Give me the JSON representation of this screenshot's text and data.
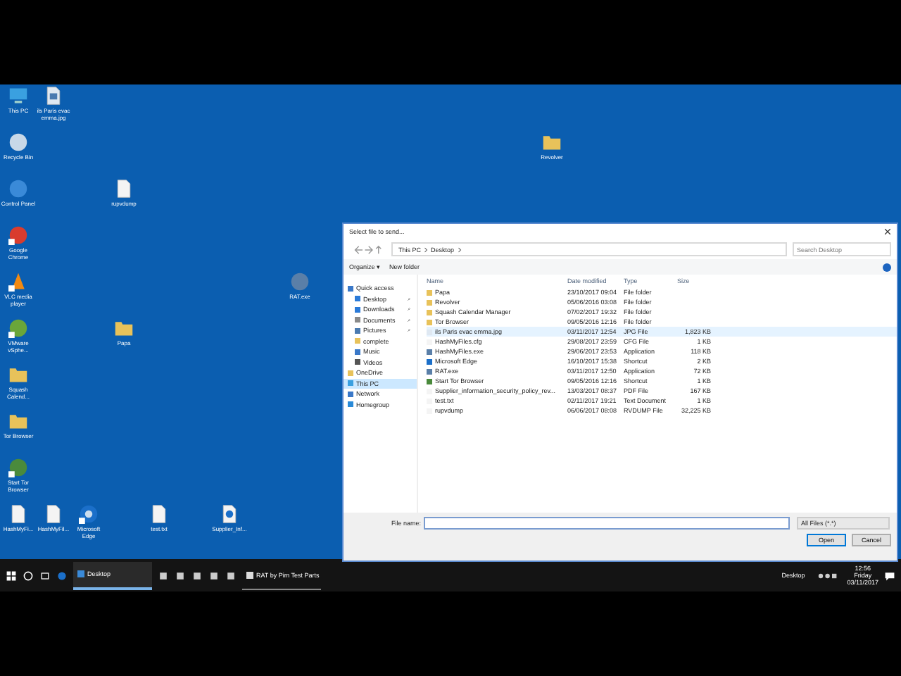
{
  "desktop_icons": [
    {
      "label": "This PC",
      "kind": "pc",
      "shortcut": false
    },
    {
      "label": "ils Paris evac emma.jpg",
      "kind": "image",
      "shortcut": false
    },
    {
      "label": "Recycle Bin",
      "kind": "recycle",
      "shortcut": false
    },
    {
      "label": "Control Panel",
      "kind": "control",
      "shortcut": false
    },
    {
      "label": "rupvdump",
      "kind": "file",
      "shortcut": false
    },
    {
      "label": "Google Chrome",
      "kind": "chrome",
      "shortcut": true
    },
    {
      "label": "VLC media player",
      "kind": "vlc",
      "shortcut": true
    },
    {
      "label": "VMware vSphe...",
      "kind": "vmware",
      "shortcut": true
    },
    {
      "label": "Papa",
      "kind": "folder",
      "shortcut": false
    },
    {
      "label": "Squash Calend...",
      "kind": "folder",
      "shortcut": false
    },
    {
      "label": "Tor Browser",
      "kind": "folder",
      "shortcut": false
    },
    {
      "label": "Start Tor Browser",
      "kind": "tor",
      "shortcut": true
    },
    {
      "label": "HashMyFi...",
      "kind": "file",
      "shortcut": false
    },
    {
      "label": "HashMyFil...",
      "kind": "file",
      "shortcut": false
    },
    {
      "label": "Microsoft Edge",
      "kind": "edge",
      "shortcut": true
    },
    {
      "label": "test.txt",
      "kind": "file",
      "shortcut": false
    },
    {
      "label": "Supplier_Inf...",
      "kind": "pdf",
      "shortcut": false
    },
    {
      "label": "RAT.exe",
      "kind": "exe",
      "shortcut": false
    },
    {
      "label": "Revolver",
      "kind": "folder",
      "shortcut": false
    }
  ],
  "dialog": {
    "title": "Select file to send...",
    "path": [
      "This PC",
      "Desktop"
    ],
    "search": {
      "placeholder": "Search Desktop"
    },
    "toolbar": [
      "Organize ▾",
      "New folder"
    ],
    "nav": [
      {
        "label": "Quick access",
        "kind": "star",
        "selected": false,
        "children": [
          {
            "label": "Desktop",
            "kind": "desktop",
            "pinned": true,
            "selected": false
          },
          {
            "label": "Downloads",
            "kind": "download",
            "pinned": true,
            "selected": false
          },
          {
            "label": "Documents",
            "kind": "docs",
            "pinned": true,
            "selected": false
          },
          {
            "label": "Pictures",
            "kind": "pictures",
            "pinned": true,
            "selected": false
          },
          {
            "label": "complete",
            "kind": "folder",
            "pinned": false,
            "selected": false
          },
          {
            "label": "Music",
            "kind": "music",
            "pinned": false,
            "selected": false
          },
          {
            "label": "Videos",
            "kind": "video",
            "pinned": false,
            "selected": false
          }
        ]
      },
      {
        "label": "OneDrive",
        "kind": "folder",
        "selected": false
      },
      {
        "label": "This PC",
        "kind": "pc",
        "selected": true
      },
      {
        "label": "Network",
        "kind": "network",
        "selected": false
      },
      {
        "label": "Homegroup",
        "kind": "home",
        "selected": false
      }
    ],
    "columns": [
      "Name",
      "Date modified",
      "Type",
      "Size"
    ],
    "rows": [
      {
        "name": "Papa",
        "date": "23/10/2017 09:04",
        "type": "File folder",
        "kind": "folder",
        "selected": false
      },
      {
        "name": "Revolver",
        "date": "05/06/2016 03:08",
        "type": "File folder",
        "kind": "folder",
        "selected": false
      },
      {
        "name": "Squash Calendar Manager",
        "date": "07/02/2017 19:32",
        "type": "File folder",
        "kind": "folder",
        "selected": false
      },
      {
        "name": "Tor Browser",
        "date": "09/05/2016 12:16",
        "type": "File folder",
        "kind": "folder",
        "selected": false
      },
      {
        "name": "ils Paris evac emma.jpg",
        "date": "03/11/2017 12:54",
        "type": "JPG File",
        "size": "1,823 KB",
        "kind": "image",
        "selected": true
      },
      {
        "name": "HashMyFiles.cfg",
        "date": "29/08/2017 23:59",
        "type": "CFG File",
        "size": "1 KB",
        "kind": "file",
        "selected": false
      },
      {
        "name": "HashMyFiles.exe",
        "date": "29/06/2017 23:53",
        "type": "Application",
        "size": "118 KB",
        "kind": "exe",
        "selected": false
      },
      {
        "name": "Microsoft Edge",
        "date": "16/10/2017 15:38",
        "type": "Shortcut",
        "size": "2 KB",
        "kind": "edge",
        "selected": false
      },
      {
        "name": "RAT.exe",
        "date": "03/11/2017 12:50",
        "type": "Application",
        "size": "72 KB",
        "kind": "exe",
        "selected": false
      },
      {
        "name": "Start Tor Browser",
        "date": "09/05/2016 12:16",
        "type": "Shortcut",
        "size": "1 KB",
        "kind": "tor",
        "selected": false
      },
      {
        "name": "Supplier_information_security_policy_rev...",
        "date": "13/03/2017 08:37",
        "type": "PDF File",
        "size": "167 KB",
        "kind": "pdf",
        "selected": false
      },
      {
        "name": "test.txt",
        "date": "02/11/2017 19:21",
        "type": "Text Document",
        "size": "1 KB",
        "kind": "file",
        "selected": false
      },
      {
        "name": "rupvdump",
        "date": "06/06/2017 08:08",
        "type": "RVDUMP File",
        "size": "32,225 KB",
        "kind": "file",
        "selected": false
      }
    ],
    "file_name": {
      "label": "File name:"
    },
    "filter": "All Files (*.*)",
    "buttons": [
      "Open",
      "Cancel"
    ]
  },
  "taskbar": {
    "items": [
      {
        "label": "Desktop",
        "kind": "folder",
        "selected": true
      },
      {
        "label": "RAT by Pim Test Parts",
        "kind": "app",
        "selected": false
      }
    ],
    "tray_label": "Desktop",
    "time": "12:56",
    "day": "Friday",
    "date": "03/11/2017"
  }
}
